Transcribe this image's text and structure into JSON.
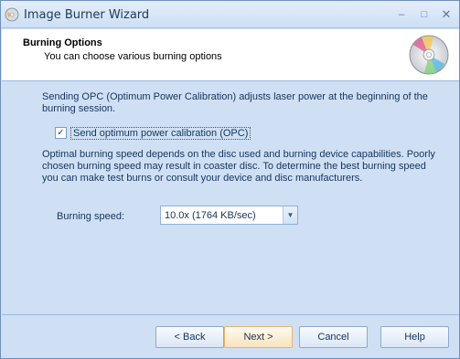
{
  "window": {
    "title": "Image Burner Wizard",
    "controls": {
      "minimize": "–",
      "maximize": "□",
      "close": "✕"
    }
  },
  "header": {
    "title": "Burning Options",
    "subtitle": "You can choose various burning options"
  },
  "content": {
    "opc_description": "Sending OPC (Optimum Power Calibration) adjusts laser power at the beginning of the burning session.",
    "opc_checkbox": {
      "label": "Send optimum power calibration (OPC)",
      "checked": true,
      "mark": "✓"
    },
    "speed_description": "Optimal burning speed depends on the disc used and burning device capabilities. Poorly chosen burning speed may result in coaster disc. To determine the best burning speed you can make test burns or consult your device and disc manufacturers.",
    "speed_label": "Burning speed:",
    "speed_value": "10.0x (1764 KB/sec)"
  },
  "buttons": {
    "back": "< Back",
    "next": "Next >",
    "cancel": "Cancel",
    "help": "Help"
  }
}
